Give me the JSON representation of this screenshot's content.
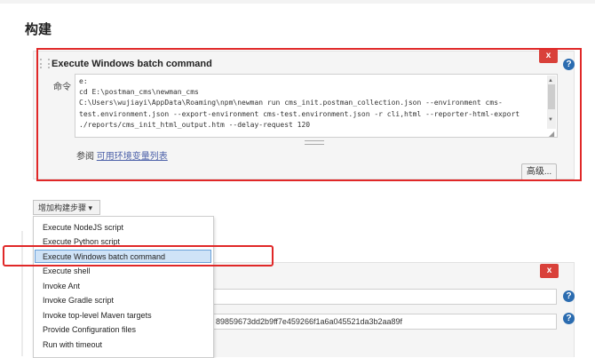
{
  "section_title": "构建",
  "step": {
    "title": "Execute Windows batch command",
    "delete_label": "x",
    "command_label": "命令",
    "command_lines": [
      "e:",
      "cd E:\\postman_cms\\newman_cms",
      "C:\\Users\\wujiayi\\AppData\\Roaming\\npm\\newman run cms_init.postman_collection.json --environment cms-",
      "test.environment.json --export-environment cms-test.environment.json -r cli,html --reporter-html-export",
      "./reports/cms_init_html_output.htm --delay-request 120"
    ],
    "see_also_prefix": "参阅",
    "see_also_link": "可用环境变量列表",
    "advanced_label": "高级..."
  },
  "help_label": "?",
  "add_step_label": "增加构建步骤",
  "add_step_arrow": "▾",
  "menu_items": [
    "Execute NodeJS script",
    "Execute Python script",
    "Execute Windows batch command",
    "Execute shell",
    "Invoke Ant",
    "Invoke Gradle script",
    "Invoke top-level Maven targets",
    "Provide Configuration files",
    "Run with timeout"
  ],
  "panel2": {
    "delete_label": "x",
    "field2_value": "89859673dd2b9ff7e459266f1a6a045521da3b2aa89f"
  },
  "colors": {
    "highlight_red": "#e02828",
    "delete_red": "#d9413a",
    "link_blue": "#4a5fa8",
    "menu_highlight": "#cfe3f7"
  }
}
